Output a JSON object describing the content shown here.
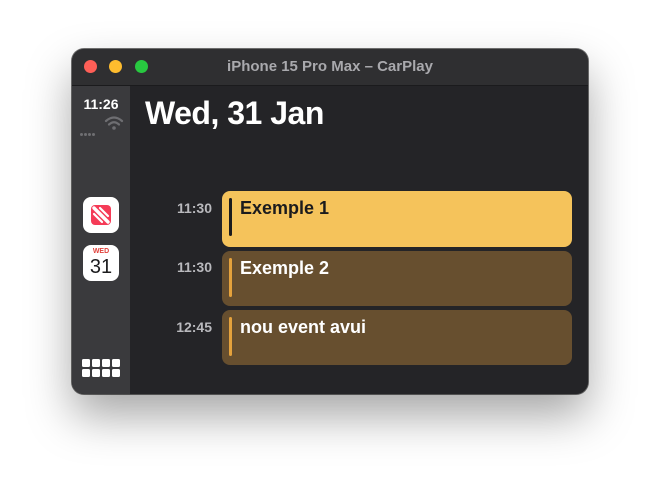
{
  "window": {
    "title": "iPhone 15 Pro Max – CarPlay"
  },
  "status": {
    "time": "11:26"
  },
  "dock": {
    "calendar_icon_dow": "WED",
    "calendar_icon_day": "31"
  },
  "calendar": {
    "date_heading": "Wed, 31 Jan",
    "events": [
      {
        "time": "11:30",
        "title": "Exemple 1",
        "selected": true
      },
      {
        "time": "11:30",
        "title": "Exemple 2",
        "selected": false
      },
      {
        "time": "12:45",
        "title": "nou event avui",
        "selected": false
      }
    ]
  },
  "colors": {
    "selected_event_bg": "#f5c35b",
    "event_bg": "#674f2f",
    "event_accent": "#e5a23c",
    "screen_bg": "#242427",
    "sidebar_bg": "#3a3a3d",
    "close": "#ff5f57",
    "minimize": "#febc2e",
    "zoom": "#28c840"
  }
}
